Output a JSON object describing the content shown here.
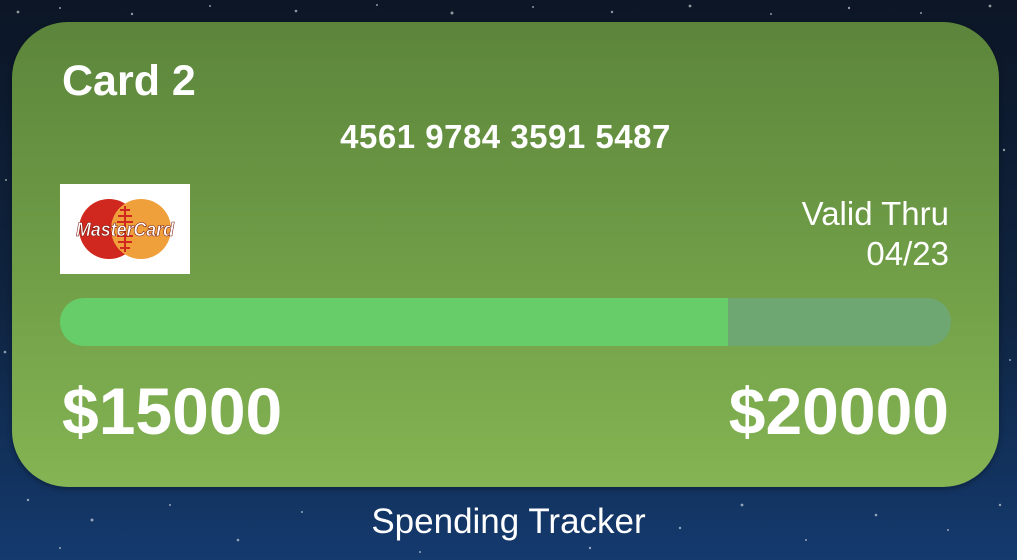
{
  "widget": {
    "card_name": "Card 2",
    "card_number": "4561 9784 3591 5487",
    "card_brand": {
      "icon": "mastercard-logo-icon",
      "wordmark": "MasterCard",
      "colors": {
        "red": "#d0281e",
        "orange": "#f0a03a"
      }
    },
    "valid_thru_label": "Valid Thru",
    "valid_thru_date": "04/23",
    "spent_amount": "$15000",
    "limit_amount": "$20000",
    "progress_fraction": 0.75,
    "colors": {
      "progress_fill": "#66cd68",
      "progress_track": "#6ea772",
      "card_top": "#5c853b",
      "card_bottom": "#84b453"
    }
  },
  "widget_label": "Spending Tracker"
}
